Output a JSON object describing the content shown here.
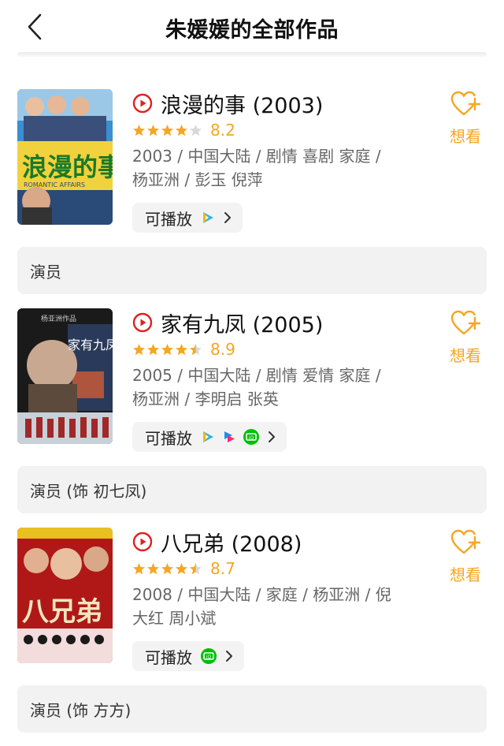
{
  "header": {
    "title": "朱媛媛的全部作品"
  },
  "items": [
    {
      "title": "浪漫的事 (2003)",
      "rating": 4.0,
      "score": "8.2",
      "meta_line1": "2003 / 中国大陆 / 剧情 喜剧 家庭 /",
      "meta_line2": "杨亚洲 / 彭玉 倪萍",
      "play_label": "可播放",
      "platforms": [
        "tencent-video"
      ],
      "want_label": "想看",
      "role": "演员",
      "poster": {
        "caption": "浪漫的事",
        "subcaption": "ROMANTIC AFFAIRS",
        "colors": [
          "#3a8fd0",
          "#f2d23c",
          "#2a4a78"
        ]
      }
    },
    {
      "title": "家有九凤 (2005)",
      "rating": 4.5,
      "score": "8.9",
      "meta_line1": "2005 / 中国大陆 / 剧情 爱情 家庭 /",
      "meta_line2": "杨亚洲 / 李明启 张英",
      "play_label": "可播放",
      "platforms": [
        "tencent-video",
        "youku",
        "iqiyi"
      ],
      "want_label": "想看",
      "role": "演员 (饰 初七凤)",
      "poster": {
        "caption": "家有九凤",
        "subcaption": "杨亚洲作品",
        "colors": [
          "#1a1a1a",
          "#5c4a3c",
          "#c8d0d8"
        ]
      }
    },
    {
      "title": "八兄弟 (2008)",
      "rating": 4.5,
      "score": "8.7",
      "meta_line1": "2008 / 中国大陆 / 家庭 / 杨亚洲 / 倪",
      "meta_line2": "大红 周小斌",
      "play_label": "可播放",
      "platforms": [
        "iqiyi"
      ],
      "want_label": "想看",
      "role": "演员 (饰 方方)",
      "poster": {
        "caption": "八兄弟",
        "subcaption": "",
        "colors": [
          "#b01818",
          "#e8c020",
          "#1a1a1a"
        ]
      }
    }
  ],
  "colors": {
    "accent": "#f5a623",
    "play_red": "#e02020",
    "chip_bg": "#f3f3f3",
    "role_bg": "#f2f2f2"
  }
}
